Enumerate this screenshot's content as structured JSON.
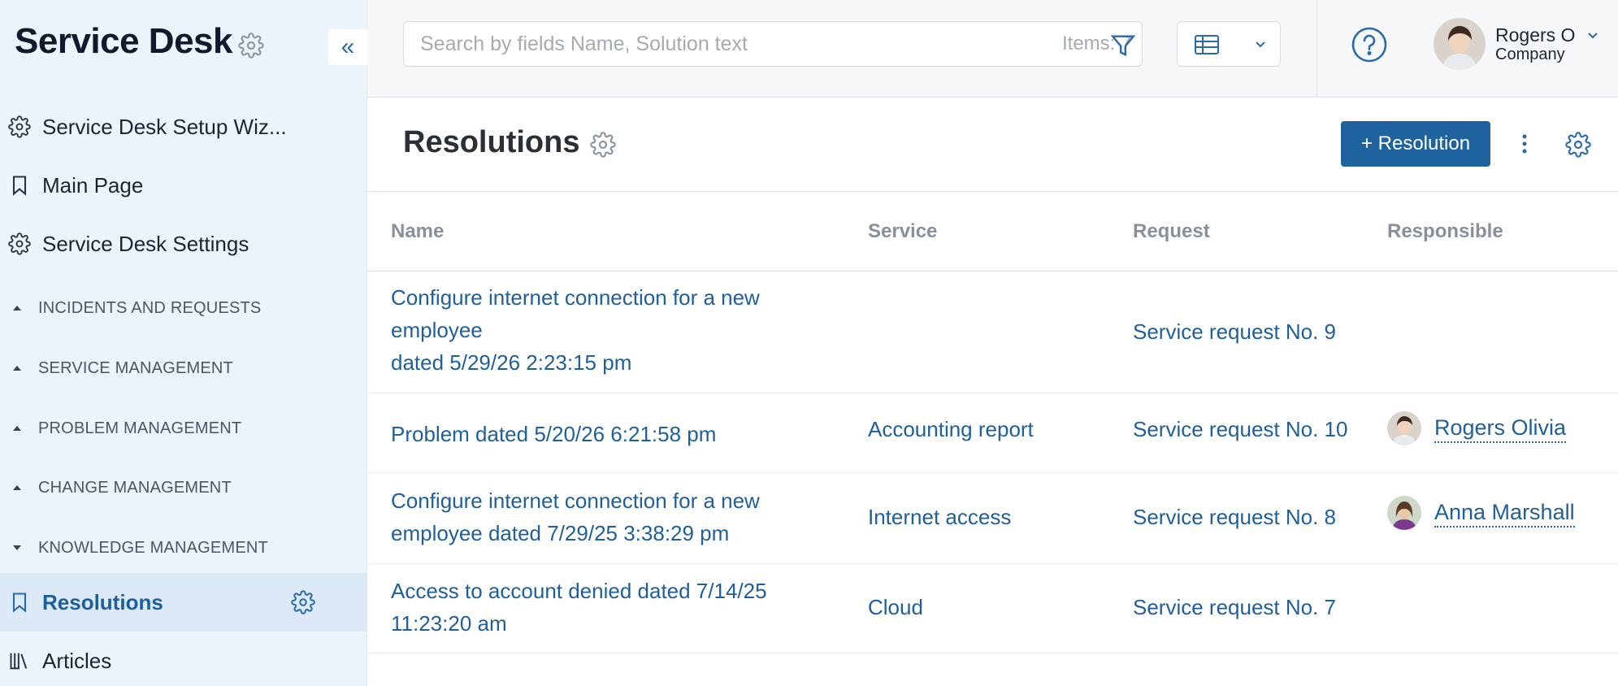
{
  "sidebar": {
    "title": "Service Desk",
    "collapse_label": "«",
    "items_top": [
      {
        "label": "Service Desk Setup Wiz...",
        "icon": "gear-icon"
      },
      {
        "label": "Main Page",
        "icon": "bookmark-icon"
      },
      {
        "label": "Service Desk Settings",
        "icon": "gear-icon"
      }
    ],
    "sections": [
      {
        "label": "INCIDENTS AND REQUESTS",
        "state": "collapsed"
      },
      {
        "label": "SERVICE MANAGEMENT",
        "state": "collapsed"
      },
      {
        "label": "PROBLEM MANAGEMENT",
        "state": "collapsed"
      },
      {
        "label": "CHANGE MANAGEMENT",
        "state": "collapsed"
      },
      {
        "label": "KNOWLEDGE MANAGEMENT",
        "state": "expanded"
      }
    ],
    "items_bottom": [
      {
        "label": "Resolutions",
        "icon": "bookmark-icon",
        "active": true
      },
      {
        "label": "Articles",
        "icon": "books-icon",
        "active": false
      }
    ]
  },
  "topbar": {
    "search_placeholder": "Search by fields Name, Solution text",
    "items_count": "Items: 7",
    "user_name": "Rogers O",
    "user_company": "Company"
  },
  "page": {
    "title": "Resolutions",
    "add_button": "+ Resolution"
  },
  "table": {
    "columns": [
      "Name",
      "Service",
      "Request",
      "Responsible"
    ],
    "rows": [
      {
        "name_lines": [
          "Configure internet connection for a new",
          "employee",
          "dated 5/29/26 2:23:15 pm"
        ],
        "service": "",
        "request": "Service request No. 9",
        "responsible": ""
      },
      {
        "name_lines": [
          "Problem dated  5/20/26 6:21:58 pm"
        ],
        "service": "Accounting report",
        "request": "Service request No. 10",
        "responsible": "Rogers Olivia"
      },
      {
        "name_lines": [
          "Configure internet connection for a new",
          "employee dated 7/29/25 3:38:29 pm"
        ],
        "service": "Internet access",
        "request": "Service request No. 8",
        "responsible": "Anna Marshall"
      },
      {
        "name_lines": [
          "Access to account denied dated 7/14/25",
          "11:23:20 am"
        ],
        "service": "Cloud",
        "request": "Service request No. 7",
        "responsible": ""
      }
    ]
  },
  "colors": {
    "accent": "#1f639e",
    "link": "#1f5f9a",
    "sidebar_bg": "#ecf3fb",
    "active_bg": "#dce9f6"
  }
}
